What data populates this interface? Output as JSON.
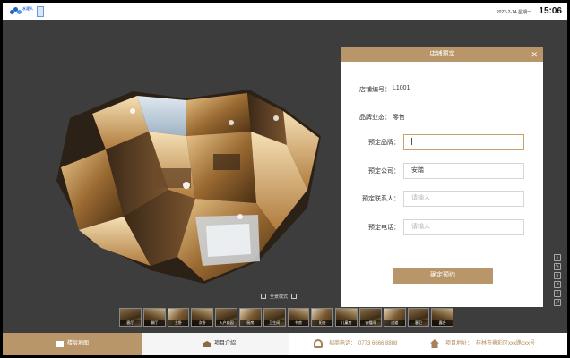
{
  "topbar": {
    "logo_text": "水泥人",
    "date": "2022-2-14 星期一",
    "time": "15:06"
  },
  "viewer": {
    "mode_label": "全景模式",
    "tools": [
      "search-icon",
      "ruler-icon",
      "layers-icon",
      "share-icon",
      "info-icon",
      "fullscreen-icon"
    ]
  },
  "thumbnails": [
    {
      "label": "客厅"
    },
    {
      "label": "餐厅"
    },
    {
      "label": "主卧"
    },
    {
      "label": "次卧"
    },
    {
      "label": "入户花园"
    },
    {
      "label": "厨房"
    },
    {
      "label": "卫生间"
    },
    {
      "label": "书房"
    },
    {
      "label": "阳台"
    },
    {
      "label": "儿童房"
    },
    {
      "label": "衣帽间"
    },
    {
      "label": "过道"
    },
    {
      "label": "客卫"
    },
    {
      "label": "露台"
    }
  ],
  "panel": {
    "title": "店铺预定",
    "shop_no_label": "店铺编号：",
    "shop_no": "L1001",
    "format_label": "品牌业态：",
    "format": "零售",
    "brand_label": "预定品牌：",
    "brand_value": "",
    "company_label": "预定公司：",
    "company_value": "安踏",
    "contact_label": "预定联系人：",
    "contact_placeholder": "请输入",
    "phone_label": "预定电话：",
    "phone_placeholder": "请输入",
    "submit_label": "确定预约"
  },
  "bottombar": {
    "tab_floorplan": "楼层地图",
    "tab_project": "项目介绍",
    "phone_label": "招商电话：",
    "phone": "0773 6666 8888",
    "address_label": "项目地址：",
    "address": "桂林市叠彩区xxx路xxx号"
  },
  "colors": {
    "accent": "#b99669",
    "viewer_bg": "#3d3d3d",
    "info_text": "#b08a5b"
  }
}
